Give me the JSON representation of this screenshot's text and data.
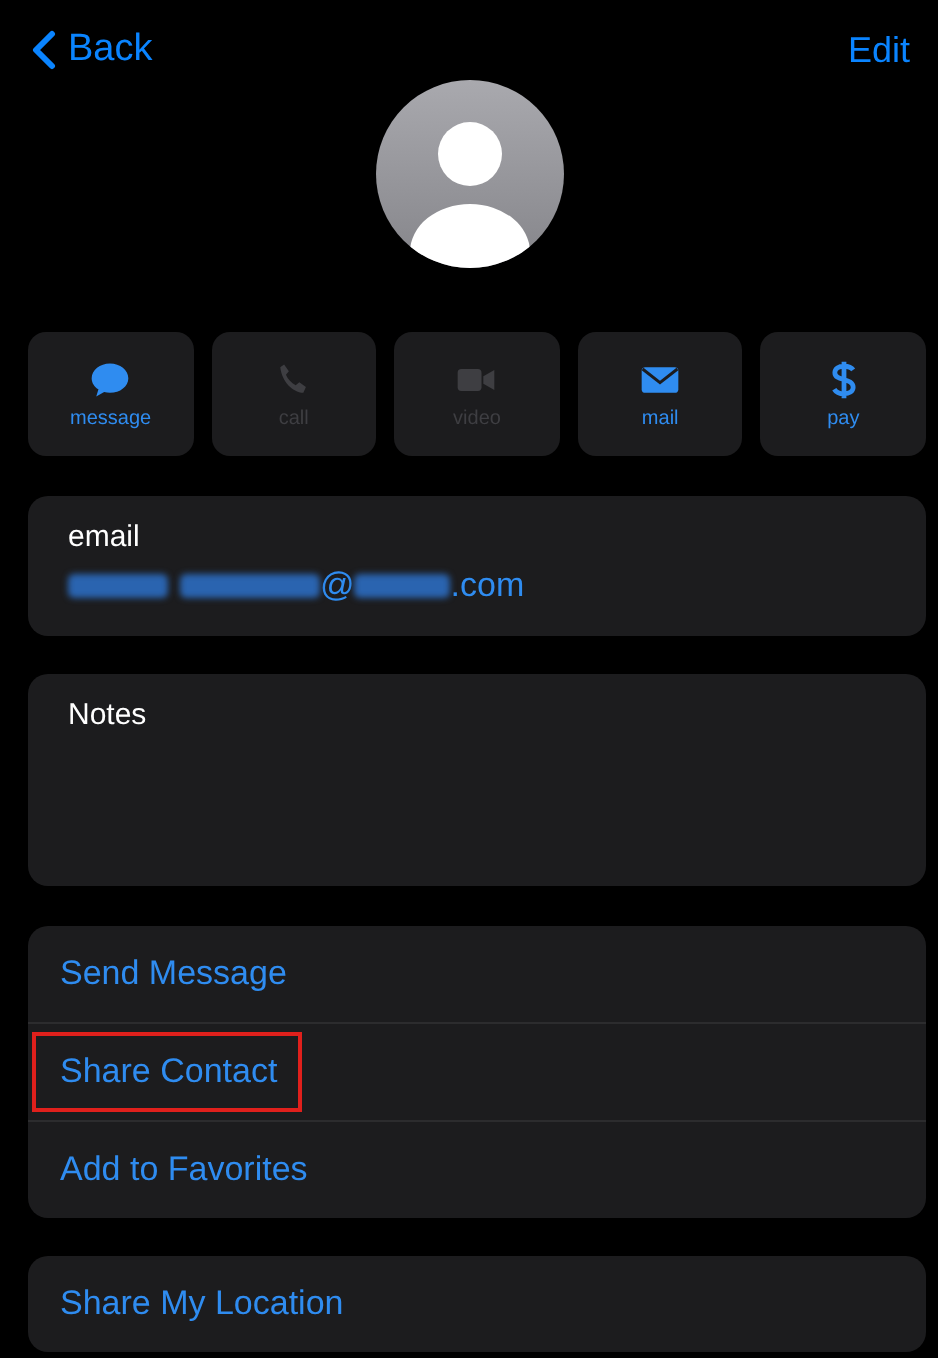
{
  "nav": {
    "back": "Back",
    "edit": "Edit"
  },
  "actions": [
    {
      "kind": "message",
      "label": "message",
      "disabled": false
    },
    {
      "kind": "call",
      "label": "call",
      "disabled": true
    },
    {
      "kind": "video",
      "label": "video",
      "disabled": true
    },
    {
      "kind": "mail",
      "label": "mail",
      "disabled": false
    },
    {
      "kind": "pay",
      "label": "pay",
      "disabled": false
    }
  ],
  "email": {
    "label": "email",
    "value_parts": [
      "@",
      ".com"
    ]
  },
  "notes": {
    "label": "Notes"
  },
  "links": [
    {
      "label": "Send Message",
      "highlighted": false
    },
    {
      "label": "Share Contact",
      "highlighted": true
    },
    {
      "label": "Add to Favorites",
      "highlighted": false
    }
  ],
  "location": {
    "label": "Share My Location"
  }
}
